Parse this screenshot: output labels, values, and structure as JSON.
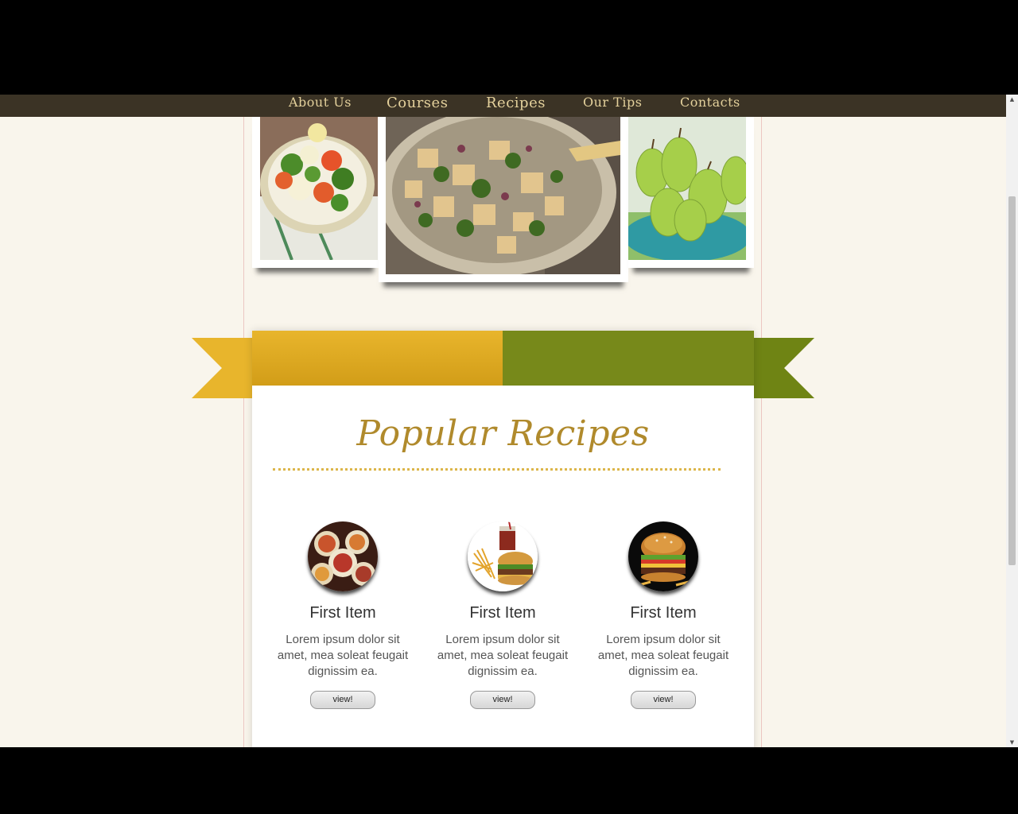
{
  "nav": {
    "items": [
      {
        "label": "About Us"
      },
      {
        "label": "Courses"
      },
      {
        "label": "Recipes"
      },
      {
        "label": "Our Tips"
      },
      {
        "label": "Contacts"
      }
    ]
  },
  "section": {
    "title": "Popular Recipes"
  },
  "cards": [
    {
      "title": "First Item",
      "text": "Lorem ipsum dolor sit amet, mea soleat feugait dignissim ea.",
      "button": "view!",
      "icon": "seafood-platter-icon"
    },
    {
      "title": "First Item",
      "text": "Lorem ipsum dolor sit amet, mea soleat feugait dignissim ea.",
      "button": "view!",
      "icon": "burger-fries-icon"
    },
    {
      "title": "First Item",
      "text": "Lorem ipsum dolor sit amet, mea soleat feugait dignissim ea.",
      "button": "view!",
      "icon": "cheeseburger-icon"
    }
  ],
  "colors": {
    "nav_bg": "#3b3325",
    "nav_text": "#e4d19c",
    "page_bg": "#f9f5ec",
    "gold": "#e3b02a",
    "green": "#77891a",
    "title": "#b08a2c"
  }
}
